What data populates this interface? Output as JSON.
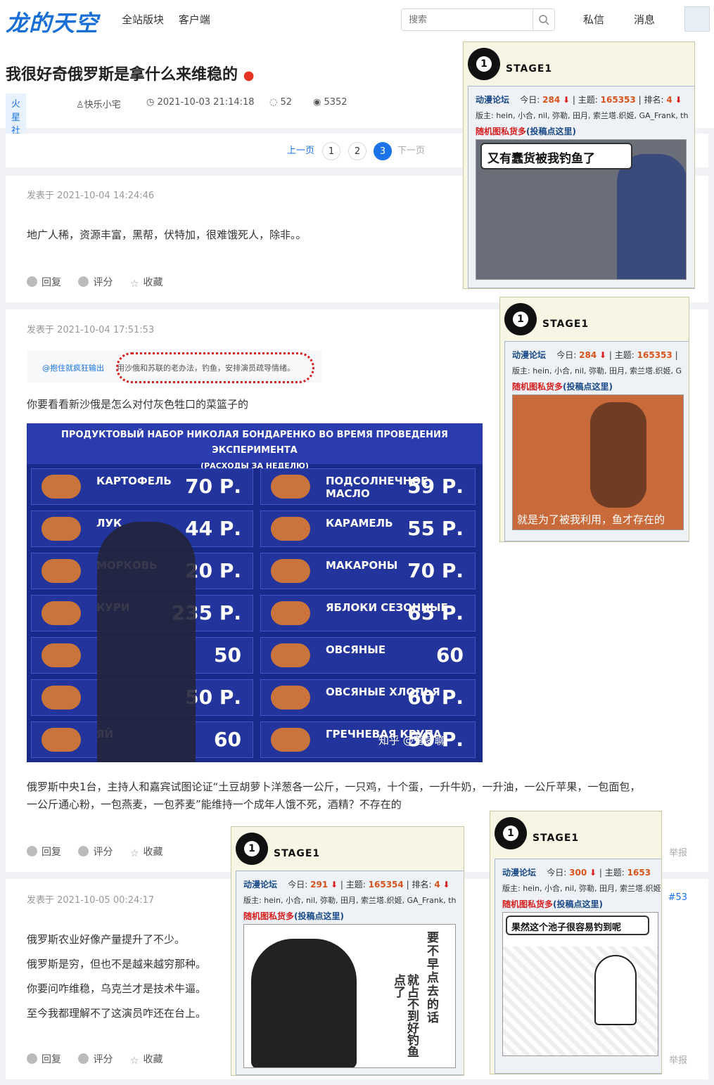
{
  "header": {
    "logo": "龙的天空",
    "nav": [
      "全站版块",
      "客户端"
    ],
    "search_placeholder": "搜索",
    "messages": "私信",
    "notifications": "消息"
  },
  "thread": {
    "title": "我很好奇俄罗斯是拿什么来维稳的",
    "category": "火星社会",
    "author": "快乐小宅",
    "datetime": "2021-10-03 21:14:18",
    "replies": "52",
    "views": "5352"
  },
  "pager": {
    "prev": "上一页",
    "pages": [
      "1",
      "2",
      "3"
    ],
    "current": "3",
    "next": "下一页"
  },
  "actions": {
    "reply": "回复",
    "rate": "评分",
    "fav": "收藏",
    "report": "举报"
  },
  "posts": [
    {
      "time": "发表于 2021-10-04 14:24:46",
      "text": "地广人稀，资源丰富，黑帮，伏特加，很难饿死人，除非。。"
    },
    {
      "time": "发表于 2021-10-04 17:51:53",
      "quote_user": "@抱住就疯狂输出",
      "quote_text": "用沙俄和苏联的老办法，钓鱼，安排演员疏导情绪。",
      "text1": "你要看看新沙俄是怎么对付灰色牲口的菜篮子的",
      "image": {
        "header_l1": "ПРОДУКТОВЫЙ НАБОР НИКОЛАЯ БОНДАРЕНКО ВО ВРЕМЯ ПРОВЕДЕНИЯ ЭКСПЕРИМЕНТА",
        "header_l2": "(РАСХОДЫ ЗА НЕДЕЛЮ)",
        "left": [
          {
            "name": "КАРТОФЕЛЬ",
            "price": "70 Р."
          },
          {
            "name": "ЛУК",
            "price": "44 Р."
          },
          {
            "name": "МОРКОВЬ",
            "price": "20 Р."
          },
          {
            "name": "КУРИ",
            "price": "235 Р."
          },
          {
            "name": "",
            "price": "50"
          },
          {
            "name": "",
            "price": "50 Р."
          },
          {
            "name": "ЯЙ",
            "price": "60"
          }
        ],
        "right": [
          {
            "name": "ПОДСОЛНЕЧНОЕ МАСЛО",
            "price": "59 Р."
          },
          {
            "name": "КАРАМЕЛЬ",
            "price": "55 Р."
          },
          {
            "name": "МАКАРОНЫ",
            "price": "70 Р."
          },
          {
            "name": "ЯБЛОКИ СЕЗОННЫЕ",
            "price": "65 Р."
          },
          {
            "name": "ОВСЯНЫЕ",
            "price": "60"
          },
          {
            "name": "ОВСЯНЫЕ ХЛОПЬЯ",
            "price": "60 Р."
          },
          {
            "name": "ГРЕЧНЕВАЯ КРУПА",
            "price": "50 Р."
          }
        ],
        "watermark": "知乎 @落梦聊"
      },
      "text2": "俄罗斯中央1台，主持人和嘉宾试图论证“土豆胡萝卜洋葱各一公斤，一只鸡，十个蛋，一升牛奶，一升油，一公斤苹果，一包面包，",
      "text3": "一公斤通心粉，一包燕麦，一包荞麦”能维持一个成年人饿不死，酒精？不存在的"
    },
    {
      "time": "发表于 2021-10-05 00:24:17",
      "floor": "#53",
      "lines": [
        "俄罗斯农业好像产量提升了不少。",
        "俄罗斯是穷，但也不是越来越穷那种。",
        "你要问咋维稳，乌克兰才是技术牛逼。",
        "至今我都理解不了这演员咋还在台上。"
      ]
    }
  ],
  "ads": [
    {
      "stage": "STAGE1",
      "forum": "动漫论坛",
      "today_label": "今日:",
      "today": "284",
      "topics_label": "主题:",
      "topics": "165353",
      "rank_label": "排名:",
      "rank": "4",
      "mods": "版主: hein, 小合, nil, 弥勒, 田月, 索兰塔.织姬, GA_Frank, th",
      "random": "随机图私货多",
      "submit": "(投稿点这里)",
      "caption": "又有蠢货被我钓鱼了"
    },
    {
      "stage": "STAGE1",
      "forum": "动漫论坛",
      "today_label": "今日:",
      "today": "284",
      "topics_label": "主题:",
      "topics": "165353",
      "mods": "版主: hein, 小合, nil, 弥勒, 田月, 索兰塔.织姬, G",
      "random": "随机图私货多",
      "submit": "(投稿点这里)",
      "caption": "就是为了被我利用，鱼才存在的"
    },
    {
      "stage": "STAGE1",
      "forum": "动漫论坛",
      "today_label": "今日:",
      "today": "291",
      "topics_label": "主题:",
      "topics": "165354",
      "rank_label": "排名:",
      "rank": "4",
      "mods": "版主: hein, 小合, nil, 弥勒, 田月, 索兰塔.织姬, GA_Frank, th",
      "random": "随机图私货多",
      "submit": "(投稿点这里)",
      "caption_a": "要不早点去的话",
      "caption_b": "就占不到好钓鱼点了"
    },
    {
      "stage": "STAGE1",
      "forum": "动漫论坛",
      "today_label": "今日:",
      "today": "300",
      "topics_label": "主题:",
      "topics": "1653",
      "mods": "版主: hein, 小合, nil, 弥勒, 田月, 索兰塔.织姬",
      "random": "随机图私货多",
      "submit": "(投稿点这里)",
      "caption": "果然这个池子很容易钓到呢"
    }
  ]
}
